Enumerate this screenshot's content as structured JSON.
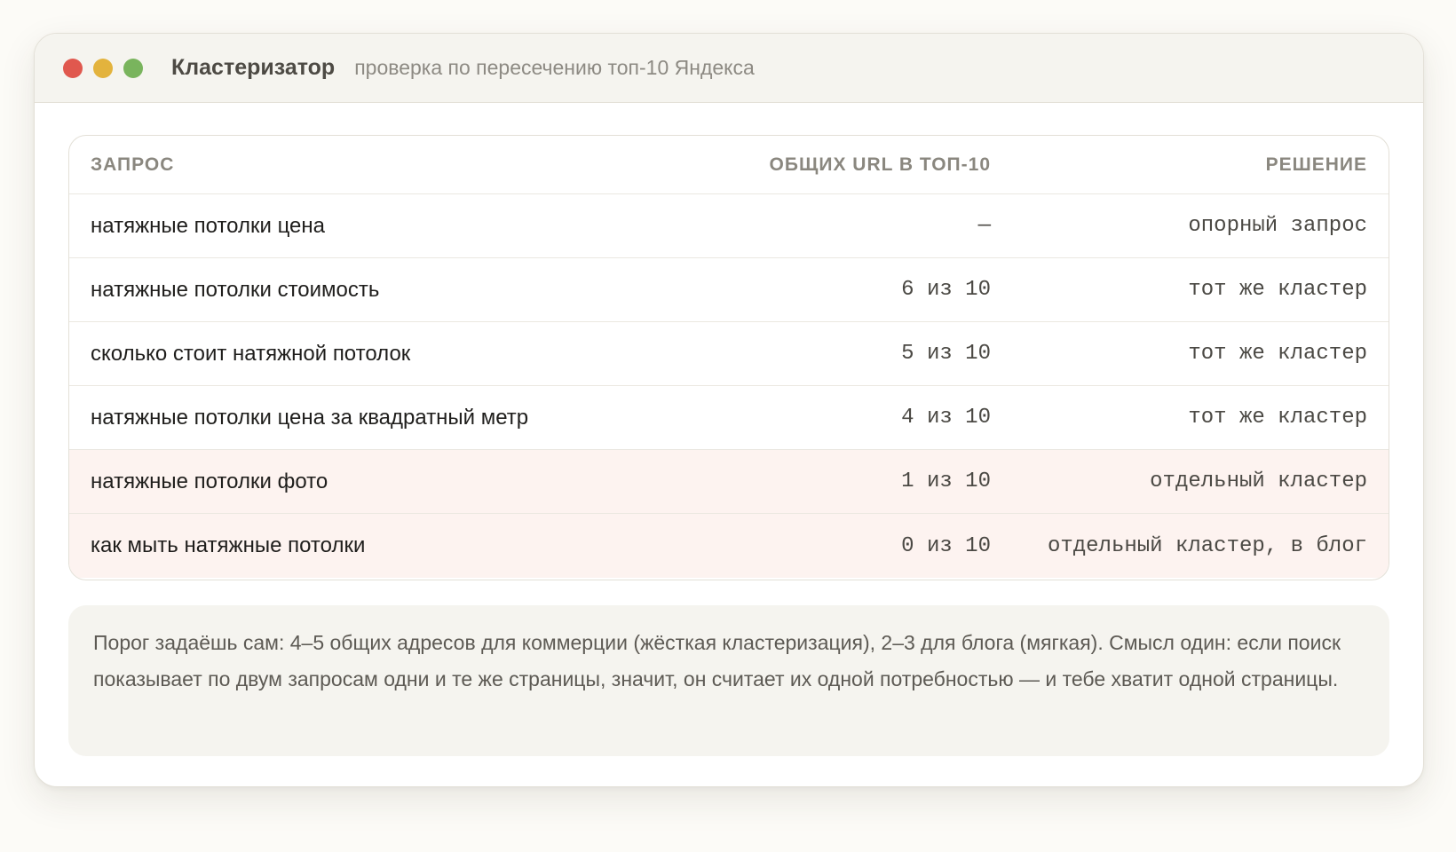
{
  "window": {
    "title": "Кластеризатор",
    "subtitle": "проверка по пересечению топ-10 Яндекса",
    "controls": [
      {
        "name": "close",
        "color": "#e0584e"
      },
      {
        "name": "minimize",
        "color": "#e3b33d"
      },
      {
        "name": "maximize",
        "color": "#79b45d"
      }
    ]
  },
  "table": {
    "headers": {
      "query": "ЗАПРОС",
      "common": "ОБЩИХ URL В ТОП-10",
      "decision": "РЕШЕНИЕ"
    },
    "rows": [
      {
        "query": "натяжные потолки цена",
        "common": "—",
        "decision": "опорный запрос",
        "highlight": false
      },
      {
        "query": "натяжные потолки стоимость",
        "common": "6 из 10",
        "decision": "тот же кластер",
        "highlight": false
      },
      {
        "query": "сколько стоит натяжной потолок",
        "common": "5 из 10",
        "decision": "тот же кластер",
        "highlight": false
      },
      {
        "query": "натяжные потолки цена за квадратный метр",
        "common": "4 из 10",
        "decision": "тот же кластер",
        "highlight": false
      },
      {
        "query": "натяжные потолки фото",
        "common": "1 из 10",
        "decision": "отдельный кластер",
        "highlight": true
      },
      {
        "query": "как мыть натяжные потолки",
        "common": "0 из 10",
        "decision": "отдельный кластер, в блог",
        "highlight": true
      }
    ]
  },
  "note": {
    "text": "Порог задаёшь сам: 4–5 общих адресов для коммерции (жёсткая кластеризация), 2–3 для блога (мягкая). Смысл один: если поиск показывает по двум запросам одни и те же страницы, значит, он считает их одной потребностью — и тебе хватит одной страницы."
  },
  "colors": {
    "highlight_row": "#fdf3f0",
    "titlebar": "#f5f4ef",
    "note_background": "#f5f4ef"
  }
}
